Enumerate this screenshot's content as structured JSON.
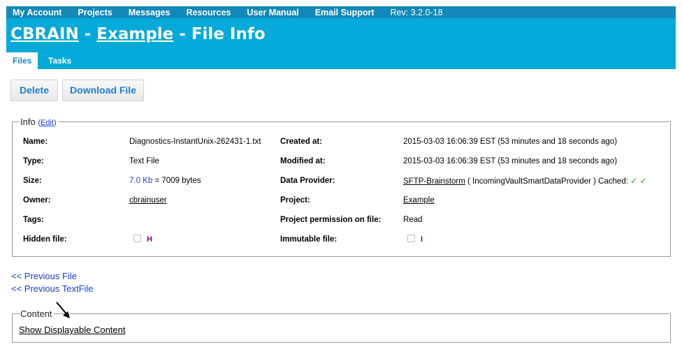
{
  "nav": {
    "items": [
      "My Account",
      "Projects",
      "Messages",
      "Resources",
      "User Manual",
      "Email Support"
    ],
    "rev": "Rev: 3.2.0-18"
  },
  "header": {
    "app": "CBRAIN",
    "sep1": " - ",
    "project": "Example",
    "sep2": " - File Info"
  },
  "tabs": [
    "Files",
    "Tasks"
  ],
  "actions": {
    "delete": "Delete",
    "download": "Download File"
  },
  "info": {
    "legend": "Info",
    "edit_open": "(",
    "edit": "Edit",
    "edit_close": ")",
    "name_label": "Name:",
    "name": "Diagnostics-InstantUnix-262431-1.txt",
    "type_label": "Type:",
    "type": "Text File",
    "size_label": "Size:",
    "size_kb": "7.0 Kb",
    "size_bytes": " = 7009 bytes",
    "owner_label": "Owner:",
    "owner": "cbrainuser",
    "tags_label": "Tags:",
    "hidden_label": "Hidden file:",
    "hidden_flag": "H",
    "created_label": "Created at:",
    "created": "2015-03-03 16:06:39 EST (53 minutes and 18 seconds ago)",
    "modified_label": "Modified at:",
    "modified": "2015-03-03 16:06:39 EST (53 minutes and 18 seconds ago)",
    "provider_label": "Data Provider:",
    "provider": "SFTP-Brainstorm",
    "provider_type": " ( IncomingVaultSmartDataProvider ) Cached: ",
    "cached": "✓ ✓",
    "project_label": "Project:",
    "project": "Example",
    "permission_label": "Project permission on file:",
    "permission": "Read",
    "immutable_label": "Immutable file:",
    "immutable_flag": "I"
  },
  "prev_file": "<< Previous File",
  "prev_textfile": "<< Previous TextFile",
  "content": {
    "legend": "Content",
    "show": "Show Displayable Content"
  }
}
